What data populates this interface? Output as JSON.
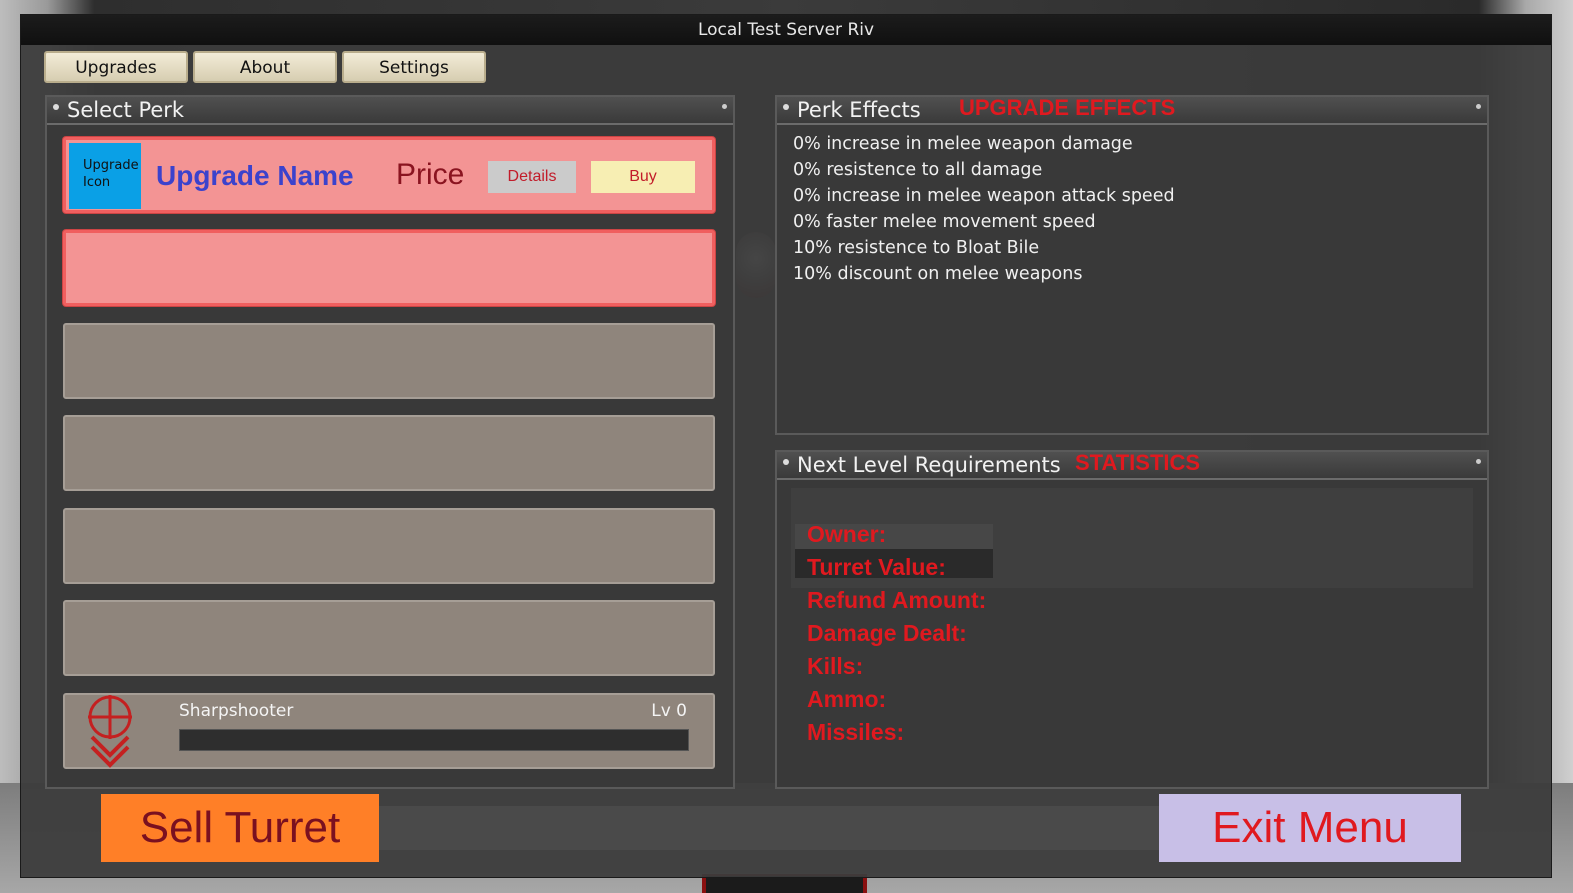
{
  "window": {
    "title": "Local Test Server Riv"
  },
  "tabs": {
    "upgrades": "Upgrades",
    "about": "About",
    "settings": "Settings"
  },
  "select_perk": {
    "title": "Select Perk",
    "upgrade_row": {
      "icon_label_1": "Upgrade",
      "icon_label_2": "Icon",
      "name": "Upgrade Name",
      "price": "Price",
      "details_label": "Details",
      "buy_label": "Buy"
    },
    "perk": {
      "name": "Sharpshooter",
      "level": "Lv 0",
      "progress": 0
    }
  },
  "perk_effects": {
    "title": "Perk Effects",
    "annotation": "UPGRADE EFFECTS",
    "lines": [
      "0% increase in melee weapon damage",
      "0% resistence to all damage",
      "0% increase in melee weapon attack speed",
      "0% faster melee movement speed",
      "10% resistence to Bloat Bile",
      "10% discount on melee weapons"
    ]
  },
  "next_level": {
    "title": "Next Level Requirements",
    "annotation": "STATISTICS",
    "stats": [
      "Owner:",
      "Turret Value:",
      "Refund Amount:",
      "Damage Dealt:",
      "Kills:",
      "Ammo:",
      "Missiles:"
    ]
  },
  "actions": {
    "sell": "Sell Turret",
    "exit": "Exit Menu"
  },
  "colors": {
    "sell_bg": "#ff7f27",
    "exit_bg": "#c8bfe7",
    "annotation": "#e0191f",
    "upgrade_name": "#3b42cc"
  }
}
